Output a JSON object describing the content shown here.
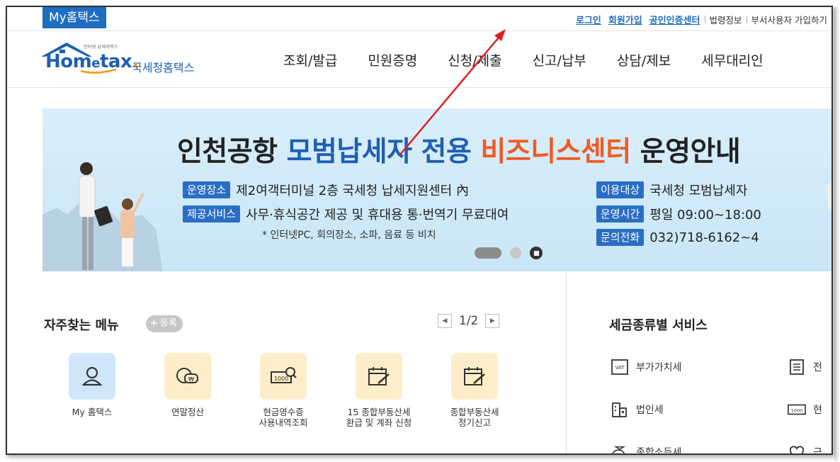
{
  "topbar": {
    "my_tab": "My홈택스",
    "links": [
      {
        "label": "로그인",
        "style": "blue"
      },
      {
        "label": "회원가입",
        "style": "blue"
      },
      {
        "label": "공인인증센터",
        "style": "blue"
      },
      {
        "label": "법령정보",
        "style": "gray"
      },
      {
        "label": "부서사용자 가입하기",
        "style": "gray"
      }
    ]
  },
  "header": {
    "logo_sub": "인터넷 납세서비스",
    "logo_word_a": "Hom",
    "logo_word_e": "e",
    "logo_word_tax": "tax",
    "logo_word_dot": ".",
    "logo_ko": "국세청홈택스",
    "nav": [
      "조회/발급",
      "민원증명",
      "신청/제출",
      "신고/납부",
      "상담/제보",
      "세무대리인"
    ]
  },
  "banner": {
    "title_part1": "인천공항 ",
    "title_part2": "모범납세자 전용 ",
    "title_part3": "비즈니스센터",
    "title_part4": " 운영안내",
    "rows": [
      {
        "tag": "운영장소",
        "text": "제2여객터미널 2층 국세청 납세지원센터 內"
      },
      {
        "tag": "제공서비스",
        "text": "사무·휴식공간 제공 및 휴대용 통·번역기 무료대여"
      },
      {
        "tag": "이용대상",
        "text": "국세청 모범납세자"
      },
      {
        "tag": "운영시간",
        "text": "평일 09:00~18:00"
      },
      {
        "tag": "문의전화",
        "text": "032)718-6162~4"
      }
    ],
    "note": "* 인터넷PC, 회의장소, 소파, 음료 등 비치"
  },
  "frequent_menu": {
    "title": "자주찾는 메뉴",
    "register_plus": "+",
    "register_label": "등록",
    "pager": "1/2",
    "items": [
      {
        "line1": "My 홈택스",
        "line2": ""
      },
      {
        "line1": "연말정산",
        "line2": ""
      },
      {
        "line1": "현금영수증",
        "line2": "사용내역조회"
      },
      {
        "line1": "15 종합부동산세",
        "line2": "환급 및 계좌 신청"
      },
      {
        "line1": "종합부동산세",
        "line2": "정기신고"
      }
    ]
  },
  "tax_services": {
    "title": "세금종류별 서비스",
    "items": [
      {
        "label": "부가가치세",
        "icon": "vat-icon",
        "icon_text": "VAT"
      },
      {
        "label": "법인세",
        "icon": "building-icon"
      },
      {
        "label": "종합소득세",
        "icon": "money-bag-icon",
        "icon_text": "₩"
      },
      {
        "label": "전",
        "icon": "document-icon"
      },
      {
        "label": "현",
        "icon": "receipt-icon",
        "icon_text": "1000"
      },
      {
        "label": "근",
        "icon": "heart-icon"
      }
    ]
  },
  "colors": {
    "brand_blue": "#1f6cc3",
    "accent_orange": "#f15a24",
    "tag_blue": "#2a6dc4",
    "annotation_red": "#e02020"
  }
}
